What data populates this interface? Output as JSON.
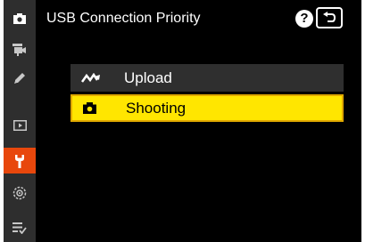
{
  "header": {
    "title": "USB Connection Priority",
    "help_label": "?"
  },
  "sidebar": {
    "items": [
      {
        "icon": "photo-shooting-icon",
        "active": false
      },
      {
        "icon": "movie-recording-icon",
        "active": false
      },
      {
        "icon": "custom-settings-pencil-icon",
        "active": false
      },
      {
        "icon": "playback-icon",
        "active": false
      },
      {
        "icon": "setup-wrench-icon",
        "active": true
      },
      {
        "icon": "network-icon",
        "active": false
      },
      {
        "icon": "my-menu-icon",
        "active": false
      }
    ],
    "active_color": "#e8470c"
  },
  "options": [
    {
      "label": "Upload",
      "icon": "upload-connection-icon",
      "selected": false
    },
    {
      "label": "Shooting",
      "icon": "camera-icon",
      "selected": true
    }
  ],
  "colors": {
    "highlight": "#ffe600",
    "background": "#000000",
    "sidebar": "#2e2e2e"
  }
}
